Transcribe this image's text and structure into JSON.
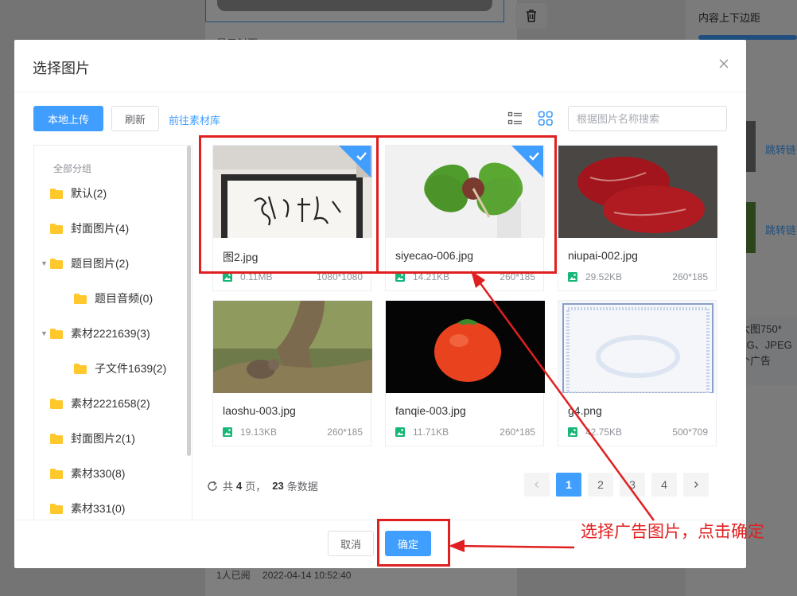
{
  "background": {
    "right_label": "内容上下边距",
    "links": [
      "跳转链",
      "跳转链"
    ],
    "note_lines": [
      "大图750*",
      "PG、JPEG",
      "个广告"
    ],
    "footer_read": "1人已阅",
    "footer_time": "2022-04-14 10:52:40",
    "top_text": "显示封面"
  },
  "dialog": {
    "title": "选择图片",
    "close_icon": "close-icon"
  },
  "toolbar": {
    "upload_label": "本地上传",
    "refresh_label": "刷新",
    "library_link": "前往素材库",
    "search_placeholder": "根据图片名称搜索"
  },
  "sidebar": {
    "root_label": "全部分组",
    "items": [
      {
        "label": "默认(2)",
        "indent": 0,
        "arrow": false
      },
      {
        "label": "封面图片(4)",
        "indent": 0,
        "arrow": false
      },
      {
        "label": "题目图片(2)",
        "indent": 0,
        "arrow": true
      },
      {
        "label": "题目音频(0)",
        "indent": 1,
        "arrow": false
      },
      {
        "label": "素材2221639(3)",
        "indent": 0,
        "arrow": true
      },
      {
        "label": "子文件1639(2)",
        "indent": 1,
        "arrow": false
      },
      {
        "label": "素材2221658(2)",
        "indent": 0,
        "arrow": false
      },
      {
        "label": "封面图片2(1)",
        "indent": 0,
        "arrow": false
      },
      {
        "label": "素材330(8)",
        "indent": 0,
        "arrow": false
      },
      {
        "label": "素材331(0)",
        "indent": 0,
        "arrow": false
      }
    ]
  },
  "images": [
    {
      "name": "图2.jpg",
      "size": "0.11MB",
      "dims": "1080*1080",
      "selected": true
    },
    {
      "name": "siyecao-006.jpg",
      "size": "14.21KB",
      "dims": "260*185",
      "selected": true
    },
    {
      "name": "niupai-002.jpg",
      "size": "29.52KB",
      "dims": "260*185",
      "selected": false
    },
    {
      "name": "laoshu-003.jpg",
      "size": "19.13KB",
      "dims": "260*185",
      "selected": false
    },
    {
      "name": "fanqie-003.jpg",
      "size": "11.71KB",
      "dims": "260*185",
      "selected": false
    },
    {
      "name": "g4.png",
      "size": "42.75KB",
      "dims": "500*709",
      "selected": false
    }
  ],
  "pagination": {
    "total_prefix": "共",
    "total_pages": "4",
    "pages_suffix": "页，",
    "total_records": "23",
    "records_suffix": "条数据",
    "pages": [
      "1",
      "2",
      "3",
      "4"
    ],
    "current": "1",
    "prev_icon": "chevron-left-icon",
    "next_icon": "chevron-right-icon"
  },
  "footer": {
    "cancel_label": "取消",
    "ok_label": "确定"
  },
  "annotation": {
    "text": "选择广告图片，点击确定",
    "color": "#e02020"
  },
  "colors": {
    "primary": "#409eff",
    "folder": "#ffc82c",
    "image_meta_icon": "#16b777"
  }
}
